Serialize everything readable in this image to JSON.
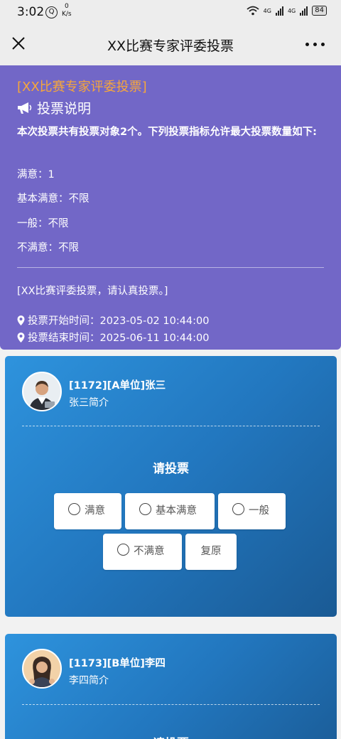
{
  "status": {
    "time": "3:02",
    "notif": "Q",
    "speed_value": "0",
    "speed_unit": "K/s",
    "net1": "4G",
    "net2": "4G",
    "battery": "84"
  },
  "nav": {
    "title": "XX比赛专家评委投票"
  },
  "header": {
    "title": "[XX比赛专家评委投票]",
    "subtitle": "投票说明",
    "desc": "本次投票共有投票对象2个。下列投票指标允许最大投票数量如下:",
    "limits": [
      "满意：1",
      "基本满意：不限",
      "一般：不限",
      "不满意：不限"
    ],
    "note": "[XX比赛评委投票，请认真投票。]",
    "start_time": "投票开始时间：2023-05-02 10:44:00",
    "end_time": "投票结束时间：2025-06-11 10:44:00"
  },
  "candidates": [
    {
      "name": "[1172][A单位]张三",
      "intro": "张三简介",
      "vote_title": "请投票",
      "options": [
        "满意",
        "基本满意",
        "一般",
        "不满意"
      ],
      "reset": "复原"
    },
    {
      "name": "[1173][B单位]李四",
      "intro": "李四简介",
      "vote_title": "请投票"
    }
  ],
  "colors": {
    "header_bg": "#7267c7",
    "title_accent": "#f7a73a",
    "card_bg": "#2277bf"
  }
}
